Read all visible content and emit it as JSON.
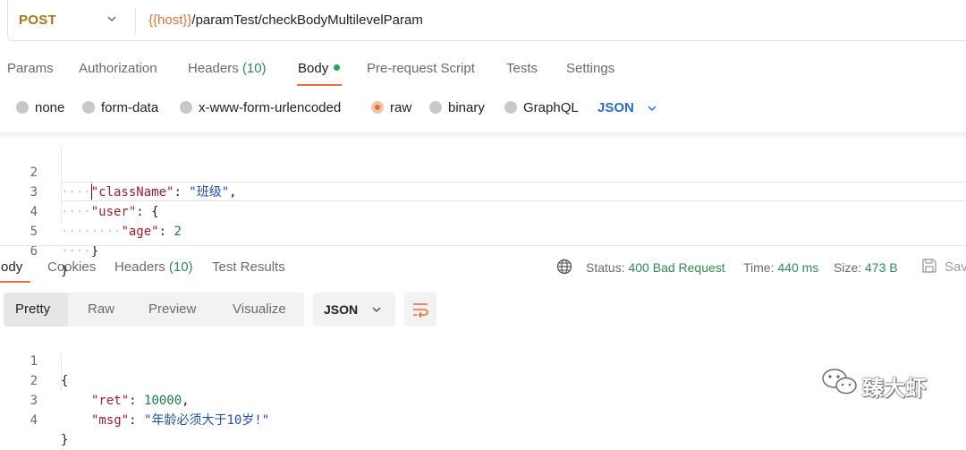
{
  "request": {
    "method": "POST",
    "url_var": "{{host}}",
    "url_path": "/paramTest/checkBodyMultilevelParam"
  },
  "req_tabs": [
    {
      "label": "Params"
    },
    {
      "label": "Authorization"
    },
    {
      "label": "Headers",
      "count": "(10)"
    },
    {
      "label": "Body"
    },
    {
      "label": "Pre-request Script"
    },
    {
      "label": "Tests"
    },
    {
      "label": "Settings"
    }
  ],
  "body_types": {
    "options": [
      "none",
      "form-data",
      "x-www-form-urlencoded",
      "raw",
      "binary",
      "GraphQL"
    ],
    "selected": "raw",
    "format": "JSON"
  },
  "request_code": {
    "lines": [
      {
        "n": "2",
        "key": "\"className\"",
        "colon": ": ",
        "value": "\"班级\"",
        "tail": ","
      },
      {
        "n": "3",
        "key": "\"user\"",
        "colon": ": ",
        "value": "",
        "tail": "{"
      },
      {
        "n": "4",
        "key": "\"age\"",
        "colon": ": ",
        "value": "2",
        "tail": ""
      },
      {
        "n": "5",
        "key": "",
        "colon": "",
        "value": "",
        "tail": "}"
      },
      {
        "n": "6",
        "key": "",
        "colon": "",
        "value": "",
        "tail": "}"
      }
    ]
  },
  "response": {
    "tabs": [
      {
        "label": "Body"
      },
      {
        "label": "Cookies"
      },
      {
        "label": "Headers",
        "count": "(10)"
      },
      {
        "label": "Test Results"
      }
    ],
    "status_label": "Status:",
    "status_value": "400 Bad Request",
    "time_label": "Time:",
    "time_value": "440 ms",
    "size_label": "Size:",
    "size_value": "473 B",
    "save_label": "Save",
    "views": [
      "Pretty",
      "Raw",
      "Preview",
      "Visualize"
    ],
    "format": "JSON",
    "code": [
      {
        "n": "1",
        "text": "{"
      },
      {
        "n": "2",
        "key": "\"ret\"",
        "colon": ": ",
        "value": "10000",
        "tail": ","
      },
      {
        "n": "3",
        "key": "\"msg\"",
        "colon": ": ",
        "value": "\"年龄必须大于10岁!\"",
        "tail": ""
      },
      {
        "n": "4",
        "text": "}"
      }
    ]
  },
  "watermark": {
    "text": "臻大虾"
  },
  "colors": {
    "accent": "#f26b3a",
    "method": "#a8741a",
    "url_var": "#e0743a",
    "status_ok_green": "#2e8b57",
    "json_blue": "#2a6ad8",
    "key_red": "#a11b2b",
    "string_blue": "#1f4fb0"
  },
  "icons": [
    "chevron-down-icon",
    "globe-icon",
    "save-icon",
    "wrap-lines-icon",
    "wechat-icon"
  ]
}
